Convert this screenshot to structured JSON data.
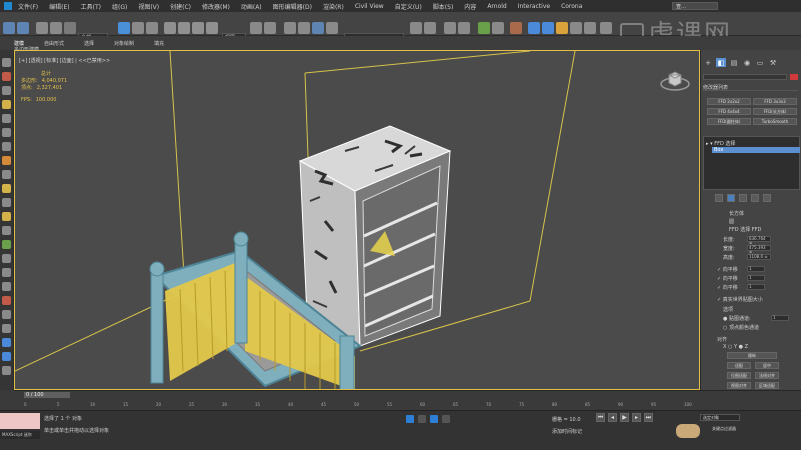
{
  "menubar": {
    "items": [
      "文件(F)",
      "编辑(E)",
      "工具(T)",
      "组(G)",
      "视图(V)",
      "创建(C)",
      "修改器(M)",
      "动画(A)",
      "图形编辑器(D)",
      "渲染(R)",
      "Civil View",
      "自定义(U)",
      "脚本(S)",
      "内容",
      "Arnold",
      "Interactive",
      "Corona"
    ],
    "search_placeholder": "查…"
  },
  "toolbar": {
    "select_filter": "全部",
    "view_label": "视图"
  },
  "ribbon": {
    "tabs": [
      "建模",
      "自由形式",
      "选择",
      "对象绘制",
      "填充"
    ],
    "sub_label": "多边形建模"
  },
  "viewport": {
    "label": "[+] [透视] [标准] [边面] | <<已禁用>>",
    "stats_title": "总计",
    "stats": [
      {
        "label": "多边形:",
        "value": "4,040,071"
      },
      {
        "label": "顶点:",
        "value": "2,327,401"
      }
    ],
    "fps_label": "FPS:",
    "fps_value": "100.000"
  },
  "command_panel": {
    "modifier_list": "修改器列表",
    "buttons": [
      "FFD 2x2x2",
      "FFD 3x3x3",
      "FFD 4x4x4",
      "FFD(长方体)",
      "FFD(圆柱体)",
      "TurboSmooth"
    ],
    "stack_root": "▸ ▾ FFD 选择",
    "stack_selected": "Box",
    "params": [
      {
        "label": "长方体",
        "value": ""
      },
      {
        "label": "圆",
        "value": ""
      },
      {
        "label": "FFD 选择 FFD",
        "value": ""
      },
      {
        "label": "长度:",
        "value": "636.764 ≑"
      },
      {
        "label": "宽度:",
        "value": "475.393 ≑"
      },
      {
        "label": "高度:",
        "value": "1108.0 ≑"
      },
      {
        "label": "✓ 向平移",
        "value": "1"
      },
      {
        "label": "✓ 向平移",
        "value": "1"
      },
      {
        "label": "✓ 向平移",
        "value": "1"
      },
      {
        "label": "✓ 真实世界贴图大小",
        "value": ""
      },
      {
        "label": "选项",
        "value": ""
      },
      {
        "label": "● 贴图通道:",
        "value": "1"
      },
      {
        "label": "○ 顶点颜色通道",
        "value": ""
      },
      {
        "label": "对齐",
        "value": ""
      },
      {
        "label": "X  ○ Y  ● Z",
        "value": ""
      },
      {
        "label": "操纵",
        "value": ""
      },
      {
        "label": "适配",
        "value": "居中"
      },
      {
        "label": "位图适配",
        "value": "法线对齐"
      },
      {
        "label": "视图对齐",
        "value": "区域适配"
      }
    ]
  },
  "timeline": {
    "frame": "0 / 100",
    "ticks": [
      "0",
      "5",
      "10",
      "15",
      "20",
      "25",
      "30",
      "35",
      "40",
      "45",
      "50",
      "55",
      "60",
      "65",
      "70",
      "75",
      "80",
      "85",
      "90",
      "95",
      "100"
    ]
  },
  "statusbar": {
    "script_label": "MAXScript 迷你",
    "selection": "选择了 1 个 对象",
    "hint": "单击或单击并拖动以选择对象",
    "grid": "栅格 = 10.0",
    "add_tag": "添加时间标记",
    "auto_key": "自动",
    "selected_set": "选定对象",
    "set_key": "设置关键点",
    "key_filter": "关键点过滤器"
  },
  "watermark": {
    "text": "虎课网"
  }
}
